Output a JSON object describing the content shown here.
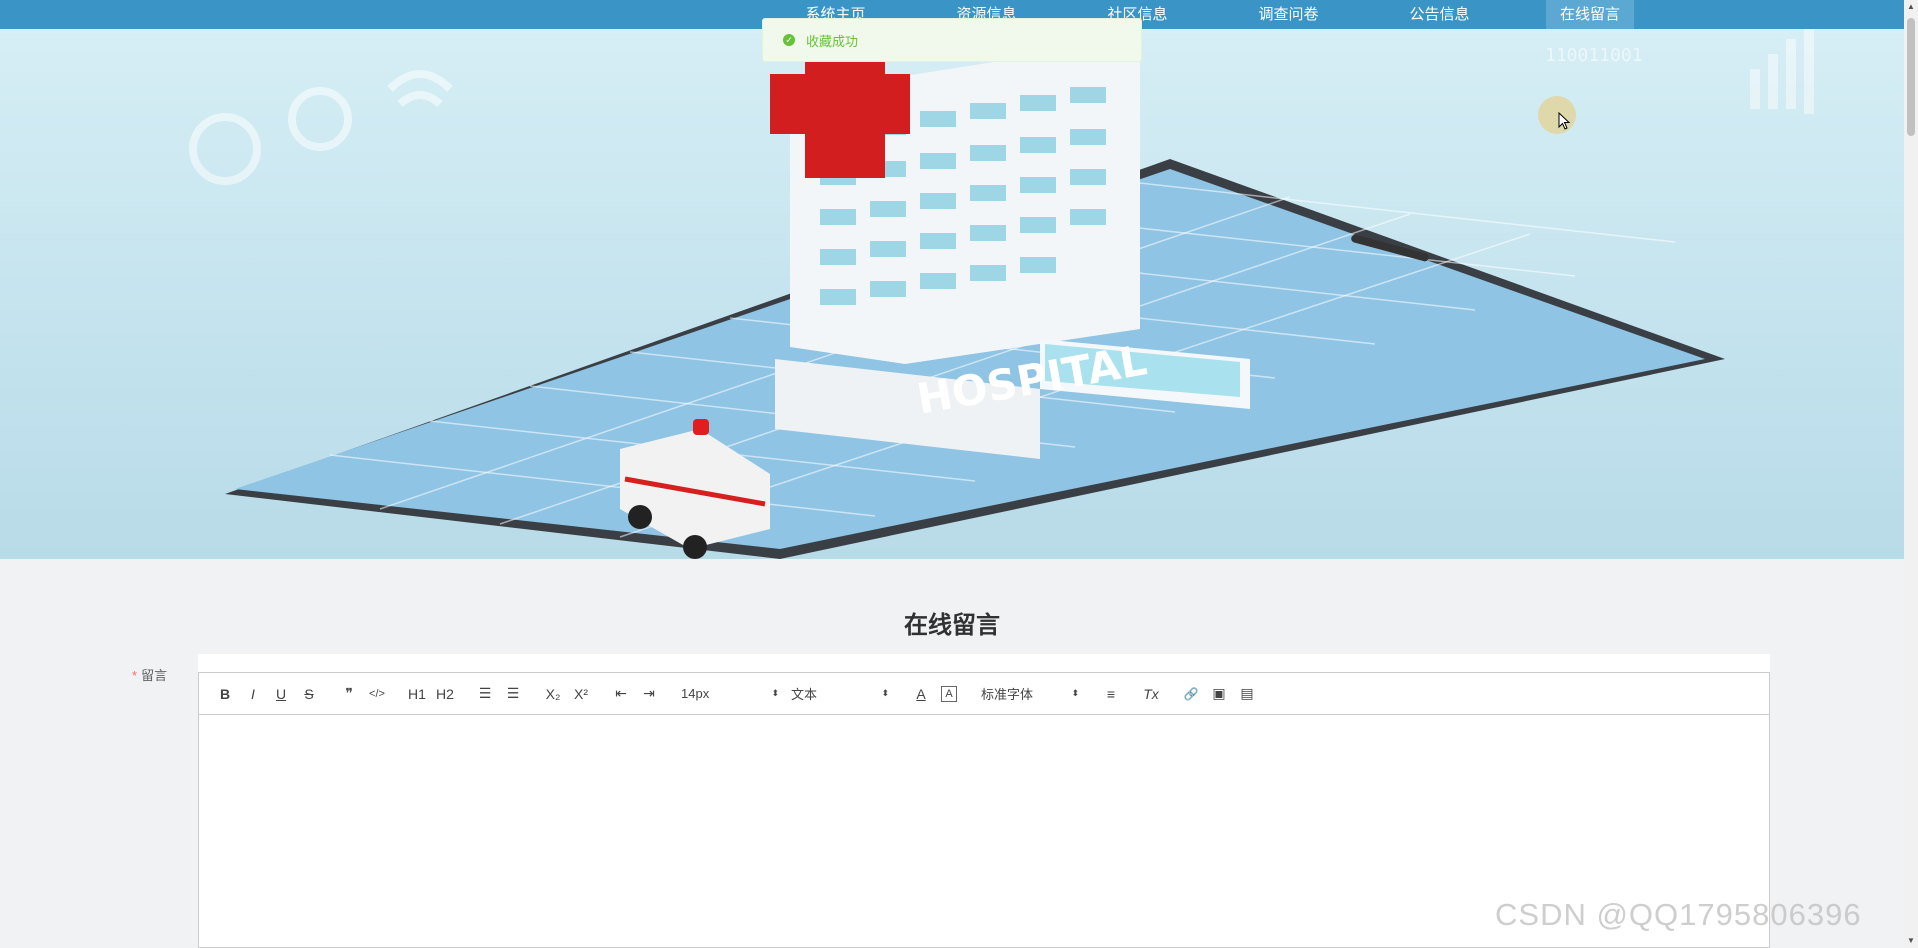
{
  "nav": {
    "brand": "",
    "items": [
      {
        "label": "系统主页"
      },
      {
        "label": "资源信息"
      },
      {
        "label": "社区信息"
      },
      {
        "label": "调查问卷"
      },
      {
        "label": "公告信息"
      },
      {
        "label": "在线留言"
      }
    ],
    "active_index": 5
  },
  "toast": {
    "message": "收藏成功",
    "icon": "check-circle-icon",
    "color": "#67c23a"
  },
  "banner": {
    "slide_count": 3,
    "active_slide": 0,
    "building_text": "HOSPITAL",
    "binary_text": "110011001"
  },
  "section": {
    "title": "在线留言"
  },
  "form": {
    "field_label": "留言",
    "required_mark": "*",
    "toolbar": {
      "bold": "B",
      "italic": "I",
      "underline": "U",
      "strike": "S",
      "quote": "❞",
      "code": "</>",
      "h1": "H1",
      "h2": "H2",
      "ol": "☰",
      "ul": "☰",
      "sub": "X₂",
      "sup": "X²",
      "outdent": "⇤",
      "indent": "⇥",
      "size": "14px",
      "header": "文本",
      "font_color": "A",
      "bg_color": "A",
      "font": "标准字体",
      "align": "≡",
      "clean": "Tx",
      "link": "🔗",
      "image": "▣",
      "video": "▤"
    }
  },
  "watermark": "CSDN @QQ1795806396",
  "colors": {
    "nav_bg": "#3a95c6",
    "active_nav": "#5ba9d3",
    "page_bg": "#f1f2f4",
    "required": "#f56c6c"
  }
}
